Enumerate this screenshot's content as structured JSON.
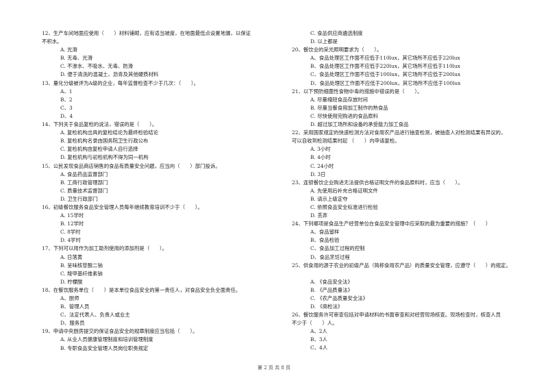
{
  "left_column": [
    {
      "number": "12",
      "text": "12、生产车间地面应使用（　　）材料铺砌，应有适当坡度，在地面最低点设置地漏，以保证",
      "continuation": "不积水。",
      "options": [
        "A. 光滑",
        "B. 无毒、光滑",
        "C. 不渗水、不吸水、无毒、防滑",
        "D. 便于清洗的混凝土、沥青及其他硬质材料"
      ]
    },
    {
      "number": "13",
      "text": "13、量化分级被评为A级的企业，每年监督检查不少于几次：（　　）。",
      "options": [
        "A、1",
        "B、2",
        "C、3",
        "D、4"
      ]
    },
    {
      "number": "14",
      "text": "14、下列关于食品复检的说法，错误的是（　　）。",
      "options": [
        "A. 复检机构出具的复检结论为最终检验结论",
        "B. 复检机构名录由国务院卫生行政公布",
        "C. 复检机构由复检申请人自行选择",
        "D. 复检机构与初检机构不得为同一机构"
      ]
    },
    {
      "number": "15",
      "text": "15、公民发现食品商店销售的食品有质量安全问题，应当向（　　）部门投诉。",
      "options": [
        "A. 食品药品监督部门",
        "B. 工商行政管理部门",
        "C. 质量技术监督部门",
        "D. 卫生行政部门"
      ]
    },
    {
      "number": "16",
      "text": "16、初级餐饮服务食品安全管理人员每年继续教育培训不少于（　　）。",
      "options": [
        "A. 15学时",
        "B. 12学时",
        "C. 8学时",
        "D. 4学时"
      ]
    },
    {
      "number": "17",
      "text": "17、下列可以用作为加工助剂使用的添加剂是（　　）。",
      "options": [
        "A. 日落黄",
        "B. 呈味核苷酸二钠",
        "C. 羧甲基纤维素钠",
        "D. 柠檬酸"
      ]
    },
    {
      "number": "18",
      "text": "18、在餐饮服务单位（　　）是本单位食品安全的第一责任人，对食品安全负全面责任。",
      "options": [
        "A、厨师",
        "B、管理人员",
        "C、法定代表人、负责人或业主",
        "D、服务员"
      ]
    },
    {
      "number": "19",
      "text": "19、申请中央厨房提交的保证食品安全的规章制度应当包括（　　）。",
      "options": [
        "A. 从业人员健康管理制度和培训管理制度",
        "B. 专职食品安全管理人员岗位职责规定"
      ]
    }
  ],
  "right_column": [
    {
      "number": "19-cont",
      "text": "",
      "options": [
        "C. 食品供应商遴选制度",
        "D. 以上都是"
      ]
    },
    {
      "number": "20",
      "text": "20、餐饮业的采光照明要求为（　　）。",
      "options": [
        "A、食品处理区工作面不应低于110lux，其它场所不应低于220lux",
        "B、食品处理区工作面不应低于220lux，其它场所不应低于110lux",
        "C、食品处理区工作面不应低于100lux，其它场所不应低于200lux",
        "D、食品处理区工作面不应低于200lux，其它场所不应低于100lux"
      ]
    },
    {
      "number": "21",
      "text": "21、以下预防细菌性食物中毒的措施中错误的是（　　）。",
      "options": [
        "A. 尽量缩短食品存放时间",
        "B. 尽量当餐食用加工制作的熟食品",
        "C. 尽快使用完购进的食品原料",
        "D. 超过加工场所和设备的承受能力加工食品"
      ]
    },
    {
      "number": "22",
      "text": "22、采用国家规定的快速检测方法对食用农产品进行抽查检测，被抽查人对检测结果有异议的，",
      "continuation": "可以自收到检测结果时起 （　　）内申请复检。",
      "options": [
        "A. 3小时",
        "B. 4小时",
        "C. 24小时",
        "D. 3日"
      ]
    },
    {
      "number": "23",
      "text": "23、连锁餐饮企业购进无法提供合格证明文件的食品原料时，应当（　　）。",
      "options": [
        "A. 先使用后补充合格证明文件",
        "B. 请示上级定夺",
        "C. 依照食品安全标准进行检验",
        "D. 丢弃"
      ]
    },
    {
      "number": "24",
      "text": "24、下列哪项是食品生产经营单位在食品安全管理中应采取的最为重要的措施？（　　）",
      "options": [
        "A、食品留样",
        "B、食品检验",
        "C、食品加工过程的控制",
        "D、食品烹饪过程"
      ]
    },
    {
      "number": "25",
      "text": "25、供食用的源于农业的初级产品（简称食用农产品）的质量安全管理，应遵守（　　）的规定。",
      "blank_line": true,
      "options": [
        "A. 《食品安全法》",
        "B. 《产品质量法》",
        "C. 《农产品质量安全法》",
        "D. 《商检法》"
      ]
    },
    {
      "number": "26",
      "text": "26、餐饮服务许可审查包括对申请材料的书面审查和对经营现场核查。现场检查时，核查人员",
      "continuation": "不少于（　　）人。",
      "options": [
        "A、2人",
        "B、3人",
        "C、4人"
      ]
    }
  ],
  "footer": {
    "page_label": "第 2 页 共 8 页"
  }
}
